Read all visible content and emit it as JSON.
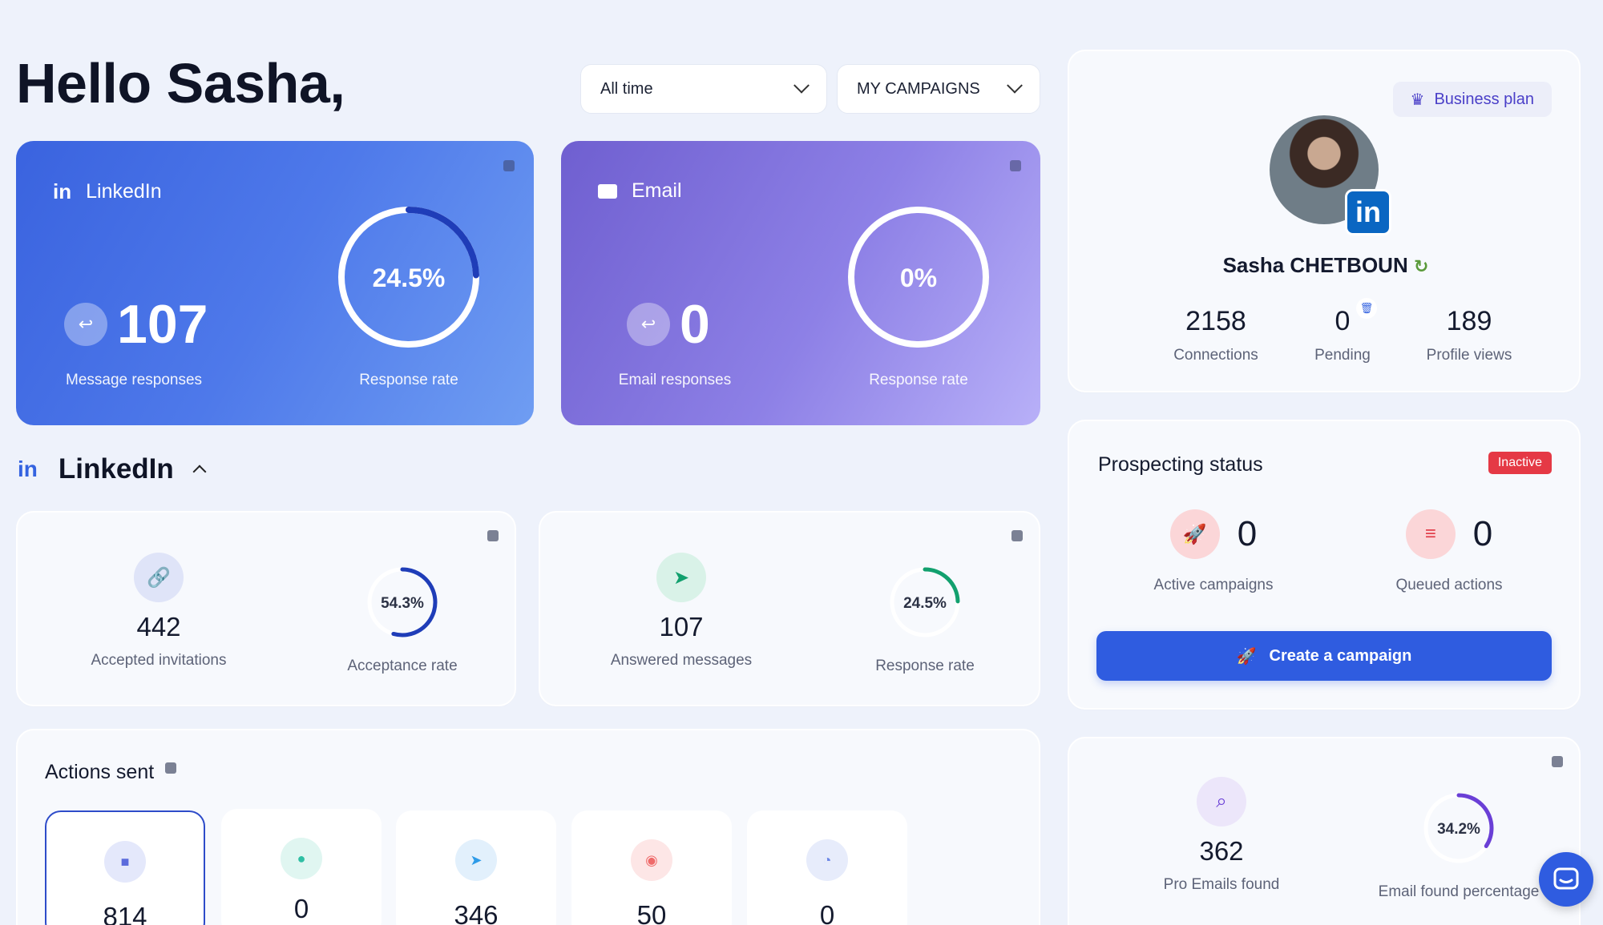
{
  "header": {
    "greeting": "Hello Sasha,",
    "time_filter": "All time",
    "campaign_filter": "MY CAMPAIGNS"
  },
  "linkedin_card": {
    "title": "LinkedIn",
    "responses": "107",
    "responses_label": "Message responses",
    "rate_text": "24.5%",
    "rate": 24.5,
    "rate_label": "Response rate"
  },
  "email_card": {
    "title": "Email",
    "responses": "0",
    "responses_label": "Email responses",
    "rate_text": "0%",
    "rate": 0,
    "rate_label": "Response rate"
  },
  "linkedin_section": {
    "title": "LinkedIn",
    "accepted": {
      "value": "442",
      "label": "Accepted invitations"
    },
    "acceptance_rate": {
      "text": "54.3%",
      "value": 54.3,
      "label": "Acceptance rate"
    },
    "answered": {
      "value": "107",
      "label": "Answered messages"
    },
    "response_rate": {
      "text": "24.5%",
      "value": 24.5,
      "label": "Response rate"
    }
  },
  "actions": {
    "title": "Actions sent",
    "tiles": [
      {
        "value": "814",
        "color": "#5b6bdc",
        "bg": "#e4e8fb"
      },
      {
        "value": "0",
        "color": "#2fbfa4",
        "bg": "#e0f6f1"
      },
      {
        "value": "346",
        "color": "#2e9be8",
        "bg": "#e2f0fc"
      },
      {
        "value": "50",
        "color": "#ef6a6a",
        "bg": "#fde6e6"
      },
      {
        "value": "0",
        "color": "#6b86e6",
        "bg": "#e7ecfb"
      }
    ]
  },
  "profile": {
    "plan": "Business plan",
    "name": "Sasha CHETBOUN",
    "connections": {
      "value": "2158",
      "label": "Connections"
    },
    "pending": {
      "value": "0",
      "label": "Pending"
    },
    "views": {
      "value": "189",
      "label": "Profile views"
    }
  },
  "prospecting": {
    "title": "Prospecting status",
    "status": "Inactive",
    "active": {
      "value": "0",
      "label": "Active campaigns"
    },
    "queued": {
      "value": "0",
      "label": "Queued actions"
    },
    "button": "Create a campaign"
  },
  "emails_found": {
    "count": {
      "value": "362",
      "label": "Pro Emails found"
    },
    "percentage": {
      "text": "34.2%",
      "value": 34.2,
      "label": "Email found percentage"
    }
  },
  "colors": {
    "accent": "#2f5ce0",
    "ring_dark_blue": "#1f3db8",
    "ring_green": "#12a06e",
    "ring_purple": "#6a3fd6",
    "inactive": "#e53945"
  }
}
